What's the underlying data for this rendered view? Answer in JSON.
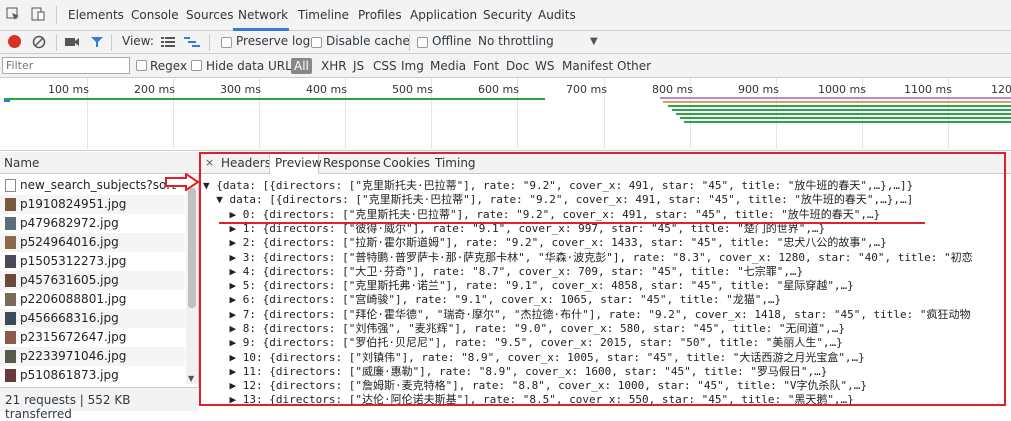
{
  "tabs": [
    "Elements",
    "Console",
    "Sources",
    "Network",
    "Timeline",
    "Profiles",
    "Application",
    "Security",
    "Audits"
  ],
  "active_tab": "Network",
  "toolbar": {
    "view_label": "View:",
    "preserve_log": "Preserve log",
    "disable_cache": "Disable cache",
    "offline": "Offline",
    "throttling": "No throttling"
  },
  "filter": {
    "placeholder": "Filter",
    "regex": "Regex",
    "hide_data_urls": "Hide data URLs",
    "all": "All",
    "types": [
      "XHR",
      "JS",
      "CSS",
      "Img",
      "Media",
      "Font",
      "Doc",
      "WS",
      "Manifest",
      "Other"
    ]
  },
  "timeline_ticks": [
    "100 ms",
    "200 ms",
    "300 ms",
    "400 ms",
    "500 ms",
    "600 ms",
    "700 ms",
    "800 ms",
    "900 ms",
    "1000 ms",
    "1100 ms",
    "120"
  ],
  "name_header": "Name",
  "files": [
    "new_search_subjects?sort=T",
    "p1910824951.jpg",
    "p479682972.jpg",
    "p524964016.jpg",
    "p1505312273.jpg",
    "p457631605.jpg",
    "p2206088801.jpg",
    "p456668316.jpg",
    "p2315672647.jpg",
    "p2233971046.jpg",
    "p510861873.jpg"
  ],
  "status": "21 requests  |  552 KB transferred",
  "detail_tabs": [
    "Headers",
    "Preview",
    "Response",
    "Cookies",
    "Timing"
  ],
  "active_detail_tab": "Preview",
  "json_lines": [
    "▼ {data: [{directors: [\"克里斯托夫·巴拉蒂\"], rate: \"9.2\", cover_x: 491, star: \"45\", title: \"放牛班的春天\",…},…]}",
    "  ▼ data: [{directors: [\"克里斯托夫·巴拉蒂\"], rate: \"9.2\", cover_x: 491, star: \"45\", title: \"放牛班的春天\",…},…]",
    "    ▶ 0: {directors: [\"克里斯托夫·巴拉蒂\"], rate: \"9.2\", cover_x: 491, star: \"45\", title: \"放牛班的春天\",…}",
    "    ▶ 1: {directors: [\"彼得·威尔\"], rate: \"9.1\", cover_x: 997, star: \"45\", title: \"楚门的世界\",…}",
    "    ▶ 2: {directors: [\"拉斯·霍尔斯道姆\"], rate: \"9.2\", cover_x: 1433, star: \"45\", title: \"忠犬八公的故事\",…}",
    "    ▶ 3: {directors: [\"普特鹏·普罗萨卡·那·萨克那卡林\", \"华森·波克彭\"], rate: \"8.3\", cover_x: 1280, star: \"40\", title: \"初恋",
    "    ▶ 4: {directors: [\"大卫·芬奇\"], rate: \"8.7\", cover_x: 709, star: \"45\", title: \"七宗罪\",…}",
    "    ▶ 5: {directors: [\"克里斯托弗·诺兰\"], rate: \"9.1\", cover_x: 4858, star: \"45\", title: \"星际穿越\",…}",
    "    ▶ 6: {directors: [\"宫崎骏\"], rate: \"9.1\", cover_x: 1065, star: \"45\", title: \"龙猫\",…}",
    "    ▶ 7: {directors: [\"拜伦·霍华德\", \"瑞奇·摩尔\", \"杰拉德·布什\"], rate: \"9.2\", cover_x: 1418, star: \"45\", title: \"疯狂动物",
    "    ▶ 8: {directors: [\"刘伟强\", \"麦兆辉\"], rate: \"9.0\", cover_x: 580, star: \"45\", title: \"无间道\",…}",
    "    ▶ 9: {directors: [\"罗伯托·贝尼尼\"], rate: \"9.5\", cover_x: 2015, star: \"50\", title: \"美丽人生\",…}",
    "    ▶ 10: {directors: [\"刘镇伟\"], rate: \"8.9\", cover_x: 1005, star: \"45\", title: \"大话西游之月光宝盒\",…}",
    "    ▶ 11: {directors: [\"威廉·惠勒\"], rate: \"8.9\", cover_x: 1600, star: \"45\", title: \"罗马假日\",…}",
    "    ▶ 12: {directors: [\"詹姆斯·麦克特格\"], rate: \"8.8\", cover_x: 1000, star: \"45\", title: \"V字仇杀队\",…}",
    "    ▶ 13: {directors: [\"达伦·阿伦诺夫斯基\"], rate: \"8.5\", cover_x: 550, star: \"45\", title: \"黑天鹅\",…}"
  ],
  "colors": {
    "accent": "#3879d9",
    "highlight": "#e0202c",
    "record": "#d93025"
  }
}
